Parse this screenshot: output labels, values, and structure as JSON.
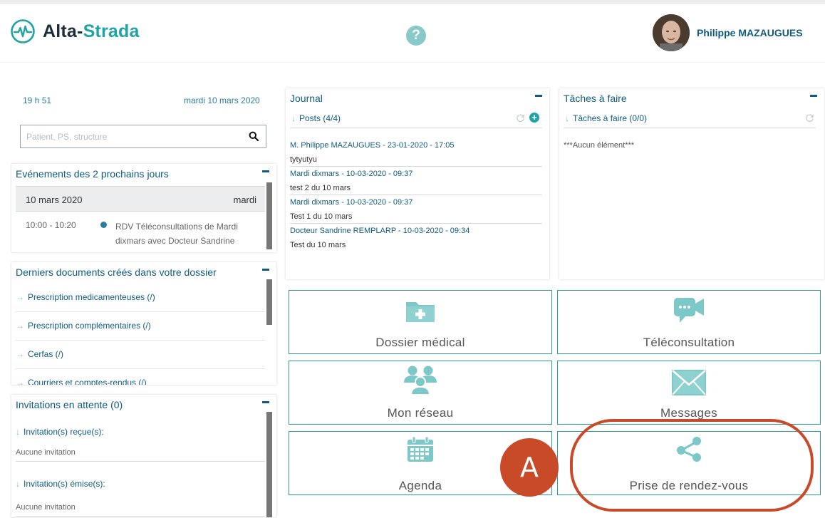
{
  "header": {
    "brand_main": "Alta-",
    "brand_accent": "Strada",
    "help_glyph": "?",
    "user_name": "Philippe MAZAUGUES"
  },
  "status": {
    "time": "19 h 51",
    "date": "mardi 10 mars 2020"
  },
  "search": {
    "placeholder": "Patient, PS, structure"
  },
  "events": {
    "title": "Evénements des 2 prochains jours",
    "day_date": "10 mars 2020",
    "day_name": "mardi",
    "items": [
      {
        "time": "10:00 - 10:20",
        "text": "RDV Téléconsultations de Mardi dixmars avec Docteur Sandrine"
      }
    ]
  },
  "documents": {
    "title": "Derniers documents créés dans votre dossier",
    "items": [
      "Prescription medicamenteuses (/)",
      "Prescription complémentaires (/)",
      "Cerfas (/)",
      "Courriers et comptes-rendus (/)"
    ]
  },
  "invitations": {
    "title": "Invitations en attente (0)",
    "received_label": "Invitation(s) reçue(s):",
    "received_empty": "Aucune invitation",
    "sent_label": "Invitation(s) émise(s):",
    "sent_empty": "Aucune invitation"
  },
  "journal": {
    "title": "Journal",
    "posts_label": "Posts (4/4)",
    "posts": [
      {
        "who": "M. Philippe MAZAUGUES - 23-01-2020 - 17:05",
        "msg": "tytyutyu"
      },
      {
        "who": "Mardi dixmars - 10-03-2020 - 09:37",
        "msg": "test 2 du 10 mars"
      },
      {
        "who": "Mardi dixmars - 10-03-2020 - 09:37",
        "msg": "Test 1 du 10 mars"
      },
      {
        "who": "Docteur Sandrine REMPLARP - 10-03-2020 - 09:34",
        "msg": "Test du 10 mars"
      }
    ]
  },
  "tasks": {
    "title": "Tâches à faire",
    "sub_label": "Tâches à faire (0/0)",
    "empty": "***Aucun élément***"
  },
  "tiles": {
    "dossier": "Dossier médical",
    "teleconsultation": "Téléconsultation",
    "reseau": "Mon réseau",
    "messages": "Messages",
    "agenda": "Agenda",
    "rdv": "Prise de rendez-vous"
  },
  "annotation": {
    "letter": "A"
  },
  "colors": {
    "brand_teal": "#20a3a5",
    "tile_icon": "#7cc8c8",
    "link_blue": "#0f5b82",
    "annotation": "#c94a29"
  }
}
